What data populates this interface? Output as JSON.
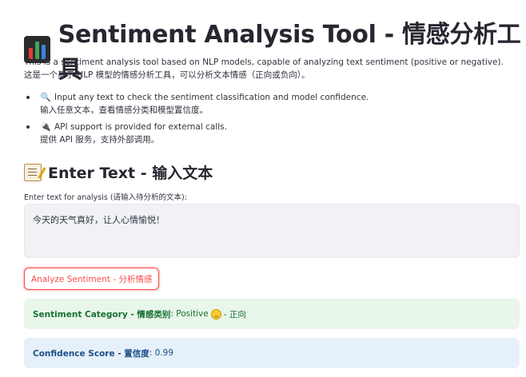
{
  "header": {
    "title": "Sentiment Analysis Tool - 情感分析工具",
    "icon": "bar-chart-icon"
  },
  "intro": {
    "line_en": "This is a sentiment analysis tool based on NLP models, capable of analyzing text sentiment (positive or negative).",
    "line_zh": "这是一个基于 NLP 模型的情感分析工具，可以分析文本情感（正向或负向）。"
  },
  "features": [
    {
      "icon": "magnifier-icon",
      "glyph": "🔍",
      "en": "Input any text to check the sentiment classification and model confidence.",
      "zh": "输入任意文本，查看情感分类和模型置信度。"
    },
    {
      "icon": "plug-icon",
      "glyph": "🔌",
      "en": "API support is provided for external calls.",
      "zh": "提供 API 服务，支持外部调用。"
    }
  ],
  "input_section": {
    "icon": "memo-icon",
    "heading": "Enter Text - 输入文本",
    "label": "Enter text for analysis (请输入待分析的文本):",
    "value": "今天的天气真好，让人心情愉悦！"
  },
  "analyze_button": {
    "label": "Analyze Sentiment - 分析情感",
    "color": "#ff4b4b"
  },
  "results": {
    "category": {
      "label": "Sentiment Category - 情感类别",
      "separator": ":",
      "value_prefix": "Positive",
      "emoji": "smiling-face-icon",
      "value_suffix": "- 正向",
      "color": "#177233",
      "background": "#e9f6ea"
    },
    "confidence": {
      "label": "Confidence Score - 置信度",
      "separator": ":",
      "value": "0.99",
      "color": "#1c4f86",
      "background": "#e6f0fa"
    }
  }
}
